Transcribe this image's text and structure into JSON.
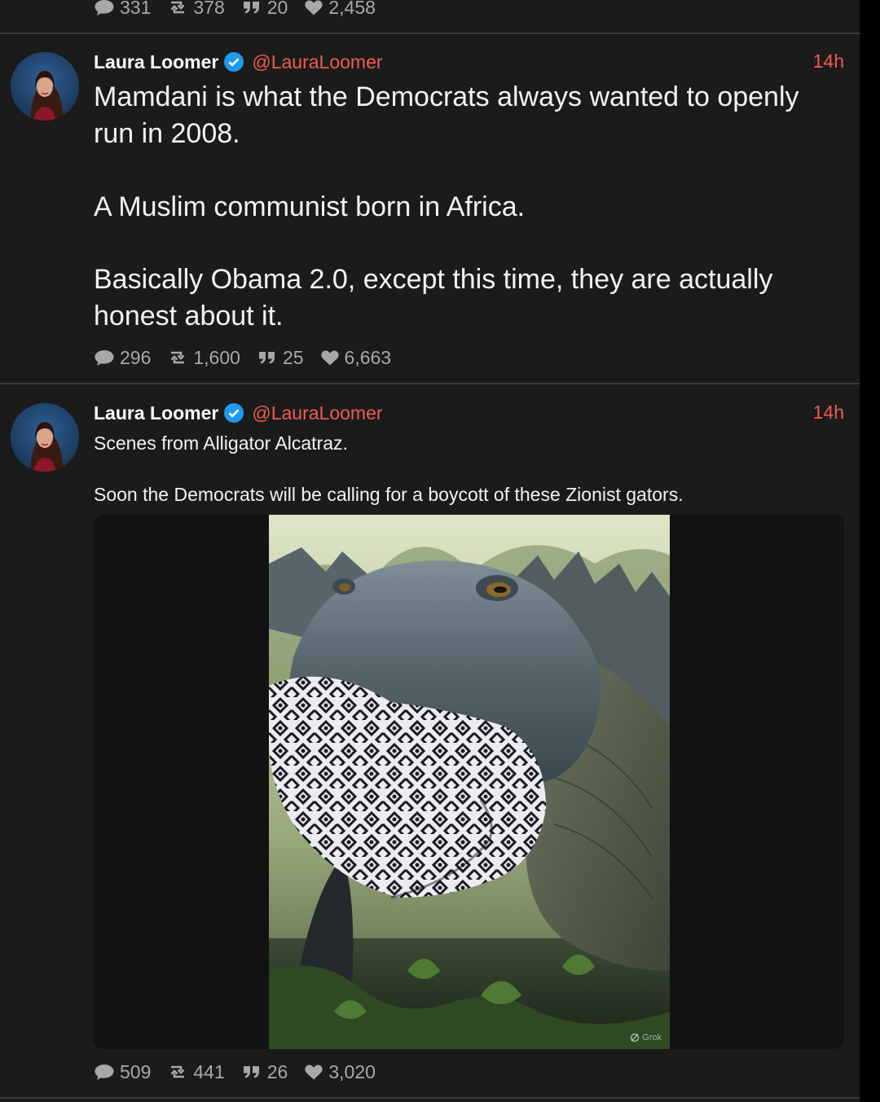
{
  "previous_post": {
    "stats": {
      "replies": "331",
      "reposts": "378",
      "quotes": "20",
      "likes": "2,458"
    }
  },
  "posts": [
    {
      "author_name": "Laura Loomer",
      "handle": "@LauraLoomer",
      "timestamp": "14h",
      "paragraphs": [
        "Mamdani is what the Democrats always wanted to openly run in 2008.",
        "A Muslim communist born in Africa.",
        "Basically Obama 2.0, except this time, they are actually honest about it."
      ],
      "stats": {
        "replies": "296",
        "reposts": "1,600",
        "quotes": "25",
        "likes": "6,663"
      }
    },
    {
      "author_name": "Laura Loomer",
      "handle": "@LauraLoomer",
      "timestamp": "14h",
      "paragraphs": [
        "Scenes from Alligator Alcatraz.",
        "Soon the Democrats will be calling for a boycott of these Zionist gators."
      ],
      "media": {
        "watermark": "Grok"
      },
      "stats": {
        "replies": "509",
        "reposts": "441",
        "quotes": "26",
        "likes": "3,020"
      }
    }
  ],
  "colors": {
    "background": "#1b1b1b",
    "accent": "#ef5b50",
    "verified": "#1d9bf0",
    "muted": "#a8a8a8"
  },
  "icons": [
    "reply-icon",
    "repost-icon",
    "quote-icon",
    "like-icon",
    "verified-badge-icon"
  ]
}
